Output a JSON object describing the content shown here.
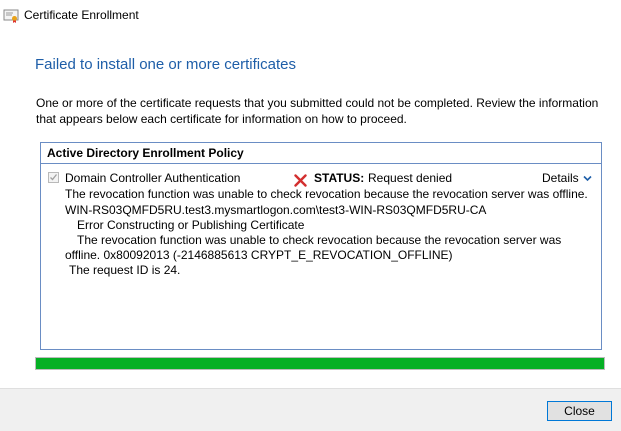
{
  "window": {
    "title": "Certificate Enrollment"
  },
  "heading": "Failed to install one or more certificates",
  "intro": "One or more of the certificate requests that you submitted could not be completed. Review the information that appears below each certificate for information on how to proceed.",
  "policy": {
    "name": "Active Directory Enrollment Policy",
    "template": "Domain Controller Authentication",
    "checked": true,
    "status_label": "STATUS:",
    "status_value": "Request denied",
    "details_label": "Details",
    "messages": [
      "The revocation function was unable to check revocation because the revocation server was offline.",
      "WIN-RS03QMFD5RU.test3.mysmartlogon.com\\test3-WIN-RS03QMFD5RU-CA",
      "Error Constructing or Publishing Certificate",
      "The revocation function was unable to check revocation because the revocation server was",
      "offline. 0x80092013 (-2146885613 CRYPT_E_REVOCATION_OFFLINE)",
      "The request ID is 24."
    ]
  },
  "progress": {
    "value": 1.0,
    "color": "#06b025"
  },
  "footer": {
    "close_label": "Close"
  },
  "colors": {
    "accent": "#1e5ea8",
    "error": "#d32f2f"
  },
  "icons": {
    "app": "certificate-icon",
    "status": "error-x-icon",
    "details": "chevron-down-icon"
  }
}
